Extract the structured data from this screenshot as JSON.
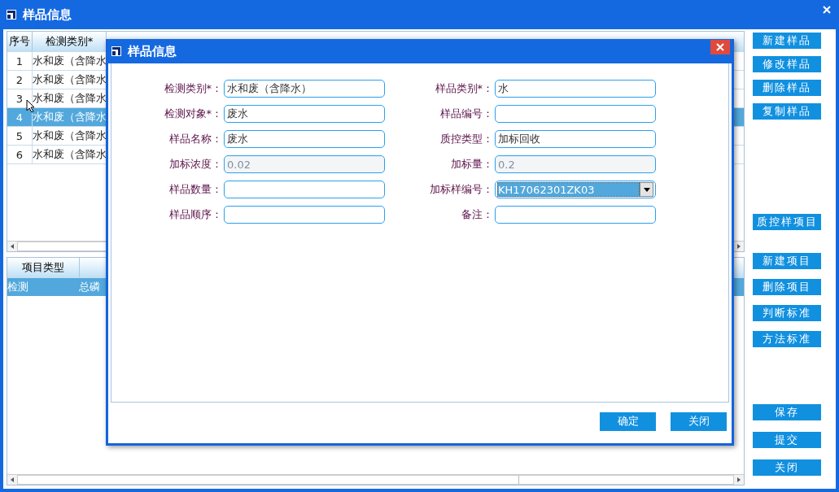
{
  "window": {
    "title": "样品信息"
  },
  "sample_table": {
    "columns": [
      "序号",
      "检测类别*"
    ],
    "rows": [
      {
        "index": "1",
        "category": "水和废（含降水",
        "selected": false
      },
      {
        "index": "2",
        "category": "水和废（含降水",
        "selected": false
      },
      {
        "index": "3",
        "category": "水和废（含降水",
        "selected": false
      },
      {
        "index": "4",
        "category": "水和废（含降水",
        "selected": true
      },
      {
        "index": "5",
        "category": "水和废（含降水",
        "selected": false
      },
      {
        "index": "6",
        "category": "水和废（含降水",
        "selected": false
      }
    ]
  },
  "item_table": {
    "columns": [
      "项目类型"
    ],
    "rows": [
      {
        "cells": [
          "检测",
          "总磷"
        ],
        "selected": true
      }
    ]
  },
  "side_button_groups": [
    [
      "新建样品",
      "修改样品",
      "删除样品",
      "复制样品"
    ],
    [
      "质控样项目"
    ],
    [
      "新建项目",
      "删除项目",
      "判断标准",
      "方法标准"
    ],
    [
      "保存",
      "提交",
      "关闭"
    ]
  ],
  "dialog": {
    "title": "样品信息",
    "fields": [
      {
        "label": "检测类别*：",
        "value": "水和废（含降水）",
        "kind": "text",
        "disabled": false
      },
      {
        "label": "样品类别*：",
        "value": "水",
        "kind": "text",
        "disabled": false
      },
      {
        "label": "检测对象*：",
        "value": "废水",
        "kind": "text",
        "disabled": false
      },
      {
        "label": "样品编号：",
        "kind": "text",
        "disabled": false
      },
      {
        "label": "样品名称：",
        "value": "废水",
        "kind": "text",
        "disabled": false
      },
      {
        "label": "质控类型：",
        "value": "加标回收",
        "kind": "text",
        "disabled": false
      },
      {
        "label": "加标浓度：",
        "value": "0.02",
        "kind": "text",
        "disabled": true
      },
      {
        "label": "加标量：",
        "value": "0.2",
        "kind": "text",
        "disabled": true
      },
      {
        "label": "样品数量：",
        "kind": "text",
        "disabled": false
      },
      {
        "label": "加标样编号：",
        "value": "KH17062301ZK03",
        "kind": "select",
        "disabled": false
      },
      {
        "label": "样品顺序：",
        "kind": "text",
        "disabled": false
      },
      {
        "label": "备注：",
        "kind": "text",
        "disabled": false
      }
    ],
    "buttons": [
      "确定",
      "关闭"
    ]
  }
}
